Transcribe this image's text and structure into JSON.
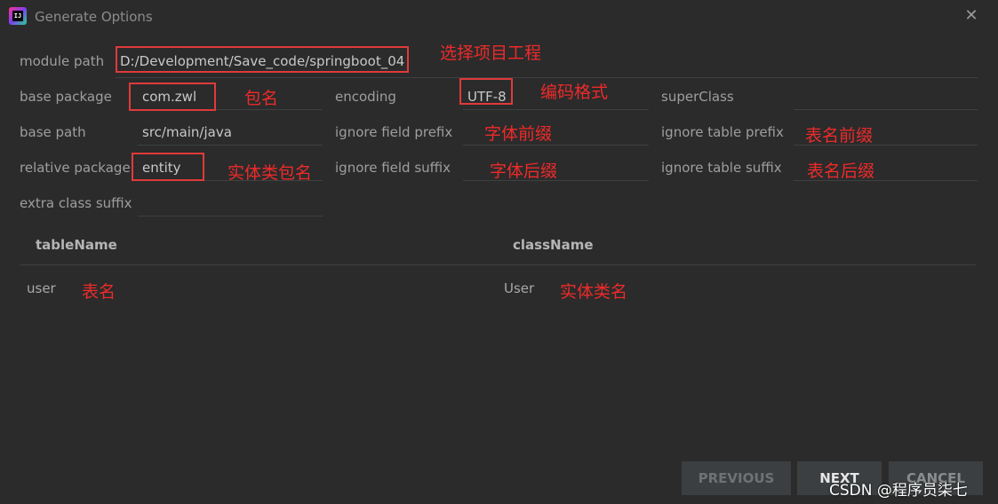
{
  "window": {
    "title": "Generate Options"
  },
  "form": {
    "module_path": {
      "label": "module path",
      "value": "D:/Development/Save_code/springboot_04"
    },
    "base_package": {
      "label": "base package",
      "value": "com.zwl"
    },
    "base_path": {
      "label": "base path",
      "value": "src/main/java"
    },
    "relative_package": {
      "label": "relative package",
      "value": "entity"
    },
    "extra_class_suffix": {
      "label": "extra class suffix",
      "value": ""
    },
    "encoding": {
      "label": "encoding",
      "value": "UTF-8"
    },
    "ignore_field_prefix": {
      "label": "ignore field prefix",
      "value": ""
    },
    "ignore_field_suffix": {
      "label": "ignore field suffix",
      "value": ""
    },
    "super_class": {
      "label": "superClass",
      "value": ""
    },
    "ignore_table_prefix": {
      "label": "ignore table prefix",
      "value": ""
    },
    "ignore_table_suffix": {
      "label": "ignore table suffix",
      "value": ""
    }
  },
  "annotations": {
    "module_path": "选择项目工程",
    "base_package": "包名",
    "encoding": "编码格式",
    "ignore_field_prefix": "字体前缀",
    "ignore_table_prefix": "表名前缀",
    "relative_package": "实体类包名",
    "ignore_field_suffix": "字体后缀",
    "ignore_table_suffix": "表名后缀",
    "table_name": "表名",
    "class_name": "实体类名"
  },
  "table": {
    "headers": [
      "tableName",
      "className"
    ],
    "rows": [
      {
        "tableName": "user",
        "className": "User"
      }
    ]
  },
  "buttons": {
    "previous": "PREVIOUS",
    "next": "NEXT",
    "cancel": "CANCEL"
  },
  "watermark": "CSDN @程序员柒七",
  "colors": {
    "annotation": "#e03a3a",
    "background": "#2b2b2b"
  }
}
